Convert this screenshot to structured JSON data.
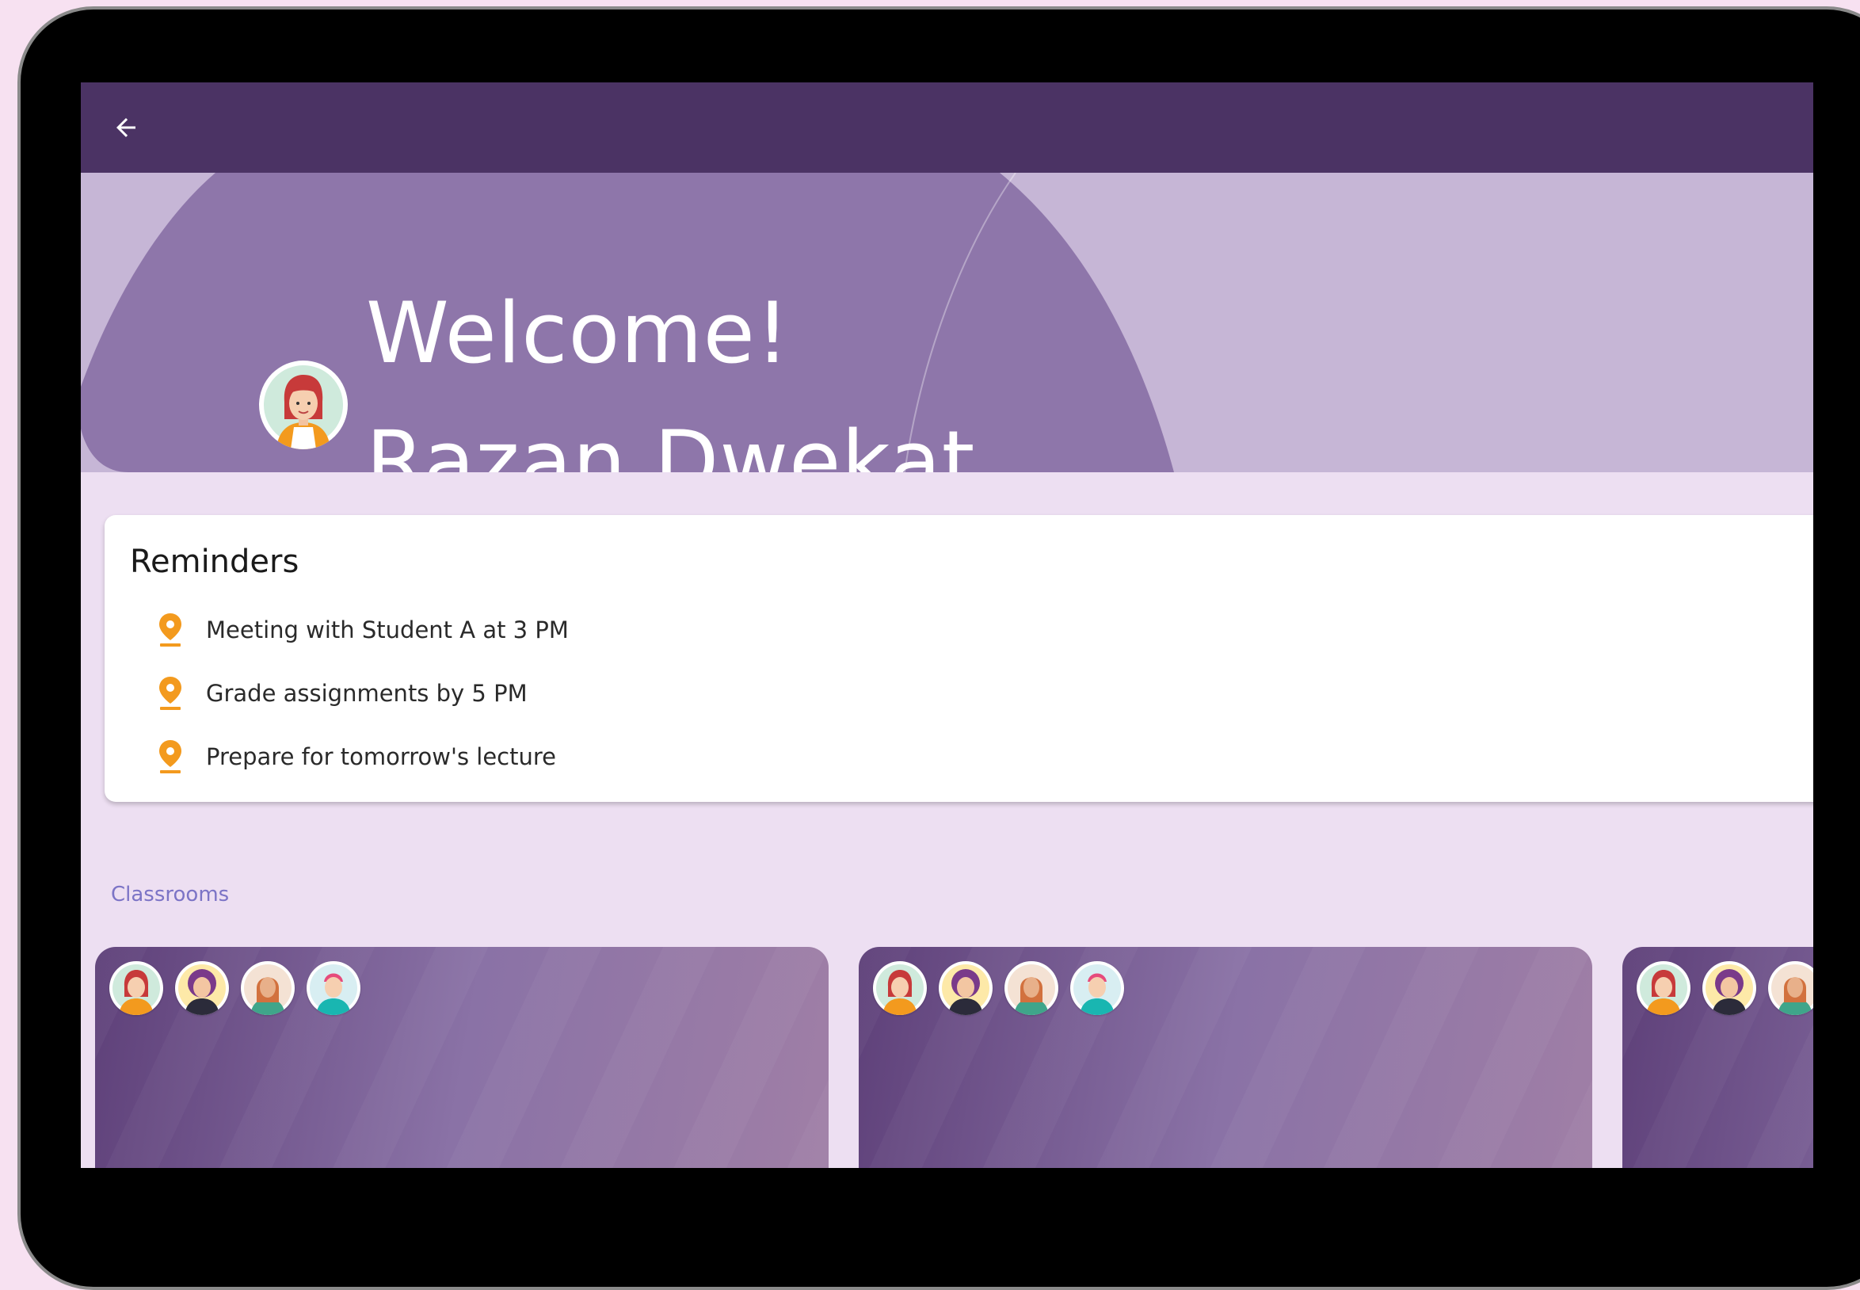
{
  "header": {
    "back_icon": "arrow-left-icon",
    "colors": {
      "appbar": "#4b3364",
      "banner_light": "#c6b6d6",
      "banner_dark": "#8e76aa"
    }
  },
  "welcome": {
    "line1": "Welcome!",
    "line2": "Razan Dwekat"
  },
  "reminders": {
    "title": "Reminders",
    "pin_icon": "location-pin-icon",
    "pin_color": "#f39a1e",
    "items": [
      {
        "text": "Meeting with Student A at 3 PM"
      },
      {
        "text": "Grade assignments by 5 PM"
      },
      {
        "text": "Prepare for tomorrow's lecture"
      }
    ]
  },
  "classrooms": {
    "label": "Classrooms",
    "label_color": "#7c74c6"
  }
}
